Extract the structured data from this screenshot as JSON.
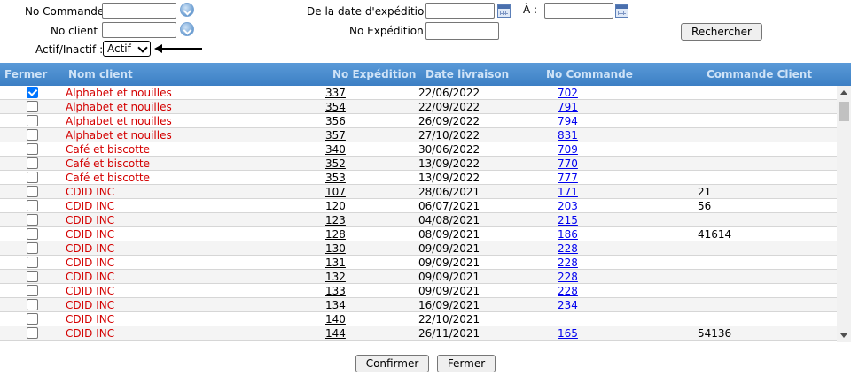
{
  "filters": {
    "no_commande_label": "No Commande:",
    "no_client_label": "No client :",
    "actif_label": "Actif/Inactif :",
    "actif_value": "Actif",
    "date_from_label": "De la date d'expédition:",
    "date_to_label": "À :",
    "no_expedition_label": "No Expédition :",
    "search_label": "Rechercher"
  },
  "table": {
    "headers": [
      "Fermer",
      "Nom client",
      "No Expédition",
      "Date livraison",
      "No Commande",
      "Commande Client"
    ],
    "rows": [
      {
        "checked": true,
        "client": "Alphabet et nouilles",
        "expedition": "337",
        "date": "22/06/2022",
        "commande": "702",
        "commande_client": ""
      },
      {
        "checked": false,
        "client": "Alphabet et nouilles",
        "expedition": "354",
        "date": "22/09/2022",
        "commande": "791",
        "commande_client": ""
      },
      {
        "checked": false,
        "client": "Alphabet et nouilles",
        "expedition": "356",
        "date": "26/09/2022",
        "commande": "794",
        "commande_client": ""
      },
      {
        "checked": false,
        "client": "Alphabet et nouilles",
        "expedition": "357",
        "date": "27/10/2022",
        "commande": "831",
        "commande_client": ""
      },
      {
        "checked": false,
        "client": "Café et biscotte",
        "expedition": "340",
        "date": "30/06/2022",
        "commande": "709",
        "commande_client": ""
      },
      {
        "checked": false,
        "client": "Café et biscotte",
        "expedition": "352",
        "date": "13/09/2022",
        "commande": "770",
        "commande_client": ""
      },
      {
        "checked": false,
        "client": "Café et biscotte",
        "expedition": "353",
        "date": "13/09/2022",
        "commande": "777",
        "commande_client": ""
      },
      {
        "checked": false,
        "client": "CDID INC",
        "expedition": "107",
        "date": "28/06/2021",
        "commande": "171",
        "commande_client": "21"
      },
      {
        "checked": false,
        "client": "CDID INC",
        "expedition": "120",
        "date": "06/07/2021",
        "commande": "203",
        "commande_client": "56"
      },
      {
        "checked": false,
        "client": "CDID INC",
        "expedition": "123",
        "date": "04/08/2021",
        "commande": "215",
        "commande_client": ""
      },
      {
        "checked": false,
        "client": "CDID INC",
        "expedition": "128",
        "date": "08/09/2021",
        "commande": "186",
        "commande_client": "41614"
      },
      {
        "checked": false,
        "client": "CDID INC",
        "expedition": "130",
        "date": "09/09/2021",
        "commande": "228",
        "commande_client": ""
      },
      {
        "checked": false,
        "client": "CDID INC",
        "expedition": "131",
        "date": "09/09/2021",
        "commande": "228",
        "commande_client": ""
      },
      {
        "checked": false,
        "client": "CDID INC",
        "expedition": "132",
        "date": "09/09/2021",
        "commande": "228",
        "commande_client": ""
      },
      {
        "checked": false,
        "client": "CDID INC",
        "expedition": "133",
        "date": "09/09/2021",
        "commande": "228",
        "commande_client": ""
      },
      {
        "checked": false,
        "client": "CDID INC",
        "expedition": "134",
        "date": "16/09/2021",
        "commande": "234",
        "commande_client": ""
      },
      {
        "checked": false,
        "client": "CDID INC",
        "expedition": "140",
        "date": "22/10/2021",
        "commande": "",
        "commande_client": ""
      },
      {
        "checked": false,
        "client": "CDID INC",
        "expedition": "144",
        "date": "26/11/2021",
        "commande": "165",
        "commande_client": "54136"
      }
    ]
  },
  "footer": {
    "confirm_label": "Confirmer",
    "close_label": "Fermer"
  },
  "icons": {
    "dropdown_icon": "blue-circle-chevron",
    "calendar_icon": "calendar-grid"
  },
  "colors": {
    "header_bg": "#4a8cce",
    "client_text": "#d40000",
    "link": "#0000ee"
  }
}
